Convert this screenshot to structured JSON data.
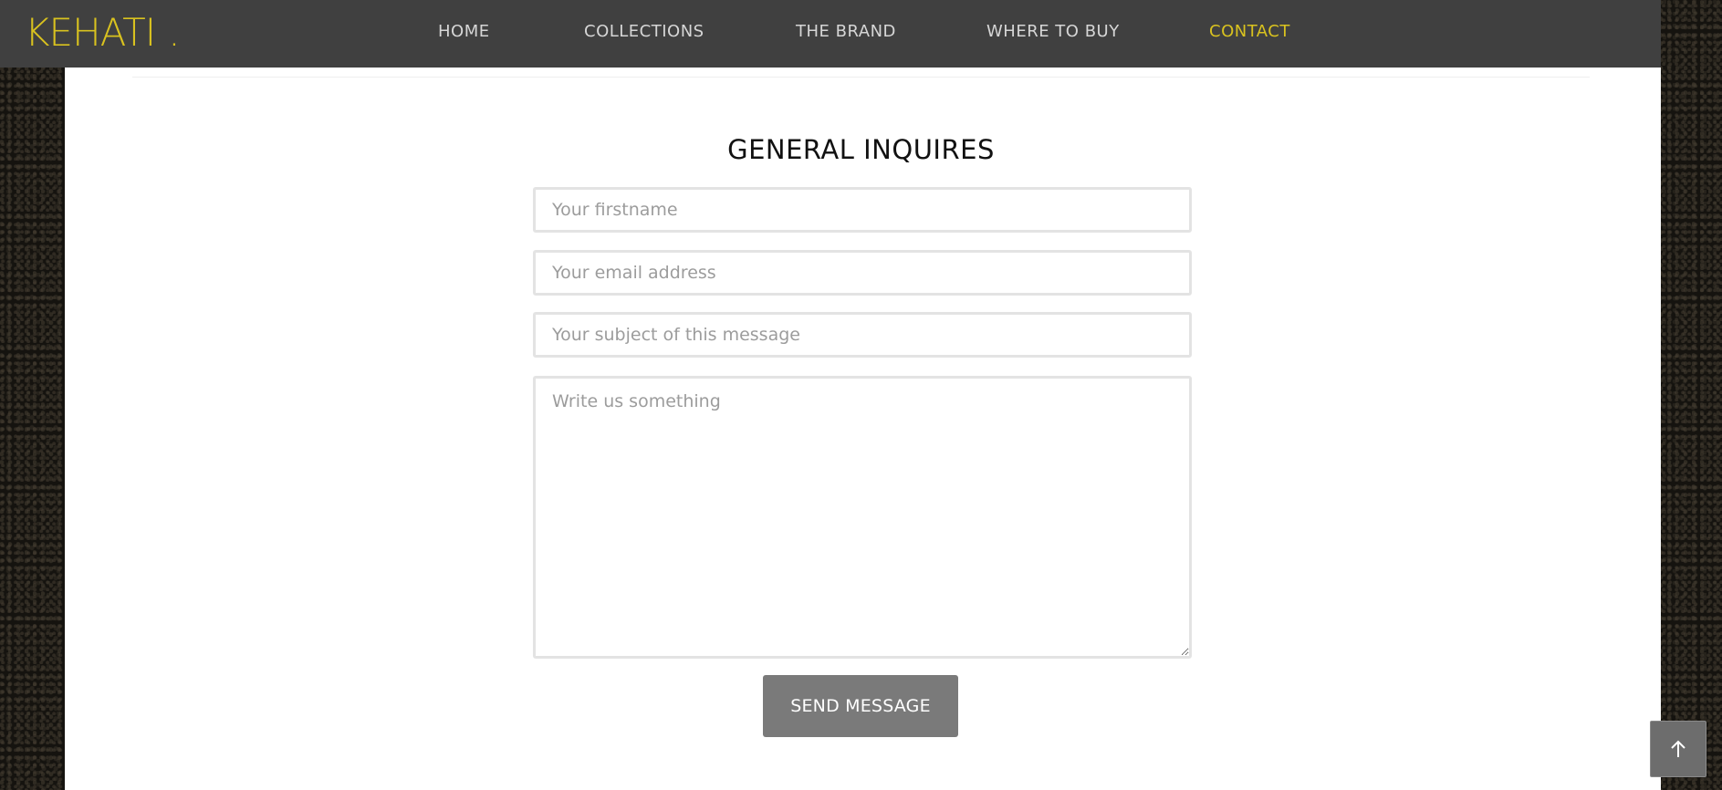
{
  "brand": {
    "name": "KEHATI",
    "dot": ".",
    "color": "#d9c21f"
  },
  "nav": {
    "items": [
      {
        "label": "HOME",
        "active": false
      },
      {
        "label": "COLLECTIONS",
        "active": false
      },
      {
        "label": "THE BRAND",
        "active": false
      },
      {
        "label": "WHERE TO BUY",
        "active": false
      },
      {
        "label": "CONTACT",
        "active": true
      }
    ]
  },
  "form": {
    "title": "GENERAL INQUIRES",
    "firstname_placeholder": "Your firstname",
    "email_placeholder": "Your email address",
    "subject_placeholder": "Your subject of this message",
    "message_placeholder": "Write us something",
    "submit_label": "SEND MESSAGE"
  },
  "scroll_top": {
    "icon": "arrow-up-icon"
  },
  "colors": {
    "topbar": "#404040",
    "accent": "#d9c21f",
    "button": "#7a7a7a"
  }
}
